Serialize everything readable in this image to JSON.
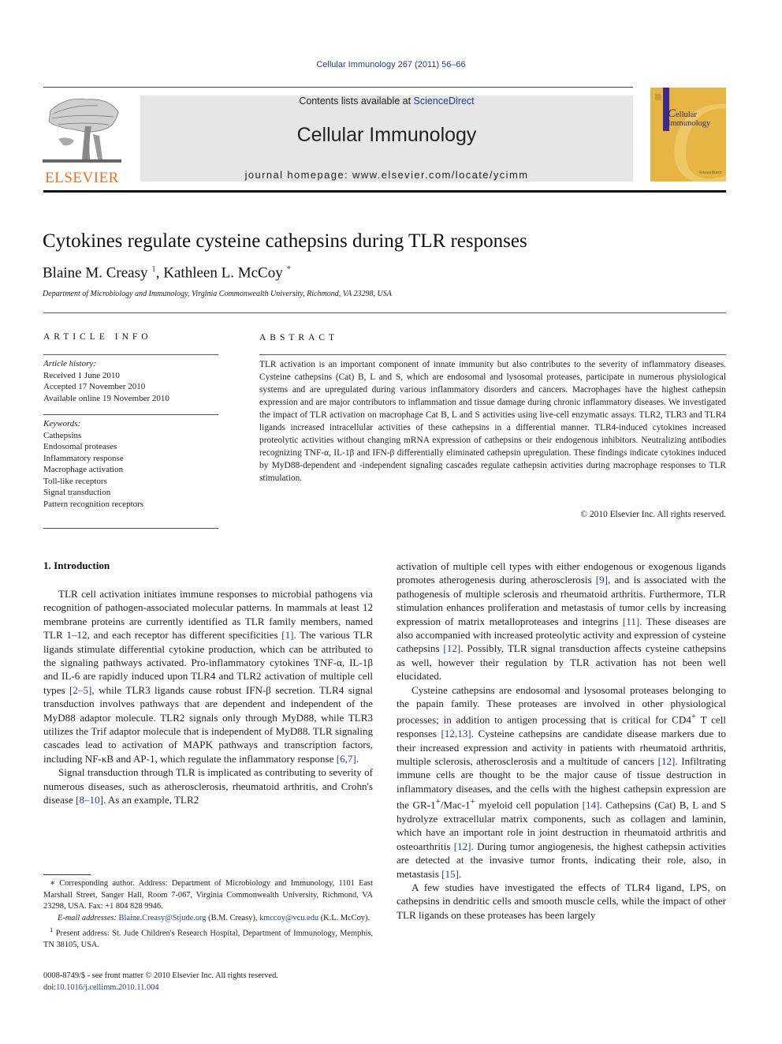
{
  "header": {
    "journal_ref": "Cellular Immunology 267 (2011) 56–66",
    "contents_prefix": "Contents lists available at ",
    "contents_link": "ScienceDirect",
    "journal_title": "Cellular Immunology",
    "homepage": "journal homepage: www.elsevier.com/locate/ycimm",
    "publisher_logo_text": "ELSEVIER",
    "cover": {
      "line1_initial": "C",
      "line1": "ellular",
      "line2": "Immunology",
      "foot": "ScienceDirect"
    },
    "colors": {
      "link": "#2b3990",
      "elsevier_orange": "#e9711c",
      "cover_gold": "#e6b544",
      "banner_grey": "#e6e6e6"
    }
  },
  "article": {
    "title": "Cytokines regulate cysteine cathepsins during TLR responses",
    "authors": [
      {
        "name": "Blaine M. Creasy",
        "mark": "1"
      },
      {
        "name": "Kathleen L. McCoy",
        "mark": "*"
      }
    ],
    "author_separator": ", ",
    "affiliation": "Department of Microbiology and Immunology, Virginia Commonwealth University, Richmond, VA 23298, USA"
  },
  "article_info": {
    "heading": "ARTICLE INFO",
    "history_label": "Article history:",
    "history": [
      "Received 1 June 2010",
      "Accepted 17 November 2010",
      "Available online 19 November 2010"
    ],
    "keywords_label": "Keywords:",
    "keywords": [
      "Cathepsins",
      "Endosomal proteases",
      "Inflammatory response",
      "Macrophage activation",
      "Toll-like receptors",
      "Signal transduction",
      "Pattern recognition receptors"
    ]
  },
  "abstract": {
    "heading": "ABSTRACT",
    "text": "TLR activation is an important component of innate immunity but also contributes to the severity of inflammatory diseases. Cysteine cathepsins (Cat) B, L and S, which are endosomal and lysosomal proteases, participate in numerous physiological systems and are upregulated during various inflammatory disorders and cancers. Macrophages have the highest cathepsin expression and are major contributors to inflammation and tissue damage during chronic inflammatory diseases. We investigated the impact of TLR activation on macrophage Cat B, L and S activities using live-cell enzymatic assays. TLR2, TLR3 and TLR4 ligands increased intracellular activities of these cathepsins in a differential manner. TLR4-induced cytokines increased proteolytic activities without changing mRNA expression of cathepsins or their endogenous inhibitors. Neutralizing antibodies recognizing TNF-α, IL-1β and IFN-β differentially eliminated cathepsin upregulation. These findings indicate cytokines induced by MyD88-dependent and -independent signaling cascades regulate cathepsin activities during macrophage responses to TLR stimulation.",
    "copyright": "© 2010 Elsevier Inc. All rights reserved."
  },
  "intro": {
    "heading": "1. Introduction",
    "left_p1": [
      {
        "t": "TLR cell activation initiates immune responses to microbial pathogens via recognition of pathogen-associated molecular patterns. In mammals at least 12 membrane proteins are currently identified as TLR family members, named TLR 1–12, and each receptor has different specificities "
      },
      {
        "c": "[1]"
      },
      {
        "t": ". The various TLR ligands stimulate differential cytokine production, which can be attributed to the signaling pathways activated. Pro-inflammatory cytokines TNF-α, IL-1β and IL-6 are rapidly induced upon TLR4 and TLR2 activation of multiple cell types "
      },
      {
        "c": "[2–5]"
      },
      {
        "t": ", while TLR3 ligands cause robust IFN-β secretion. TLR4 signal transduction involves pathways that are dependent and independent of the MyD88 adaptor molecule. TLR2 signals only through MyD88, while TLR3 utilizes the Trif adaptor molecule that is independent of MyD88. TLR signaling cascades lead to activation of MAPK pathways and transcription factors, including NF-κB and AP-1, which regulate the inflammatory response "
      },
      {
        "c": "[6,7]"
      },
      {
        "t": "."
      }
    ],
    "left_p2": [
      {
        "t": "Signal transduction through TLR is implicated as contributing to severity of numerous diseases, such as atherosclerosis, rheumatoid arthritis, and Crohn's disease "
      },
      {
        "c": "[8–10]"
      },
      {
        "t": ". As an example, TLR2 "
      }
    ],
    "right_p1": [
      {
        "t": "activation of multiple cell types with either endogenous or exogenous ligands promotes atherogenesis during atherosclerosis "
      },
      {
        "c": "[9]"
      },
      {
        "t": ", and is associated with the pathogenesis of multiple sclerosis and rheumatoid arthritis. Furthermore, TLR stimulation enhances proliferation and metastasis of tumor cells by increasing expression of matrix metalloproteases and integrins "
      },
      {
        "c": "[11]"
      },
      {
        "t": ". These diseases are also accompanied with increased proteolytic activity and expression of cysteine cathepsins "
      },
      {
        "c": "[12]"
      },
      {
        "t": ". Possibly, TLR signal transduction affects cysteine cathepsins as well, however their regulation by TLR activation has not been well elucidated."
      }
    ],
    "right_p2": [
      {
        "t": "Cysteine cathepsins are endosomal and lysosomal proteases belonging to the papain family. These proteases are involved in other physiological processes; in addition to antigen processing that is critical for CD4"
      },
      {
        "s": "+"
      },
      {
        "t": " T cell responses "
      },
      {
        "c": "[12,13]"
      },
      {
        "t": ". Cysteine cathepsins are candidate disease markers due to their increased expression and activity in patients with rheumatoid arthritis, multiple sclerosis, atherosclerosis and a multitude of cancers "
      },
      {
        "c": "[12]"
      },
      {
        "t": ". Infiltrating immune cells are thought to be the major cause of tissue destruction in inflammatory diseases, and the cells with the highest cathepsin expression are the GR-1"
      },
      {
        "s": "+"
      },
      {
        "t": "/Mac-1"
      },
      {
        "s": "+"
      },
      {
        "t": " myeloid cell population "
      },
      {
        "c": "[14]"
      },
      {
        "t": ". Cathepsins (Cat) B, L and S hydrolyze extracellular matrix components, such as collagen and laminin, which have an important role in joint destruction in rheumatoid arthritis and osteoarthritis "
      },
      {
        "c": "[12]"
      },
      {
        "t": ". During tumor angiogenesis, the highest cathepsin activities are detected at the invasive tumor fronts, indicating their role, also, in metastasis "
      },
      {
        "c": "[15]"
      },
      {
        "t": "."
      }
    ],
    "right_p3": [
      {
        "t": "A few studies have investigated the effects of TLR4 ligand, LPS, on cathepsins in dendritic cells and smooth muscle cells, while the impact of other TLR ligands on these proteases has been largely"
      }
    ]
  },
  "footnotes": {
    "corresponding": "∗ Corresponding author. Address: Department of Microbiology and Immunology, 1101 East Marshall Street, Sanger Hall, Room 7-067, Virginia Commonwealth University, Richmond, VA 23298, USA. Fax: +1 804 828 9946.",
    "email_label": "E-mail addresses:",
    "email1": "Blaine.Creasy@Stjude.org",
    "email1_owner": " (B.M. Creasy), ",
    "email2": "kmccoy@vcu.edu",
    "email2_owner": " (K.L. McCoy).",
    "present_mark": "1",
    "present": " Present address: St. Jude Children's Research Hospital, Department of Immunology, Memphis, TN 38105, USA.",
    "issn": "0008-8749/$ - see front matter © 2010 Elsevier Inc. All rights reserved.",
    "doi_prefix": "doi:",
    "doi": "10.1016/j.cellimm.2010.11.004"
  }
}
